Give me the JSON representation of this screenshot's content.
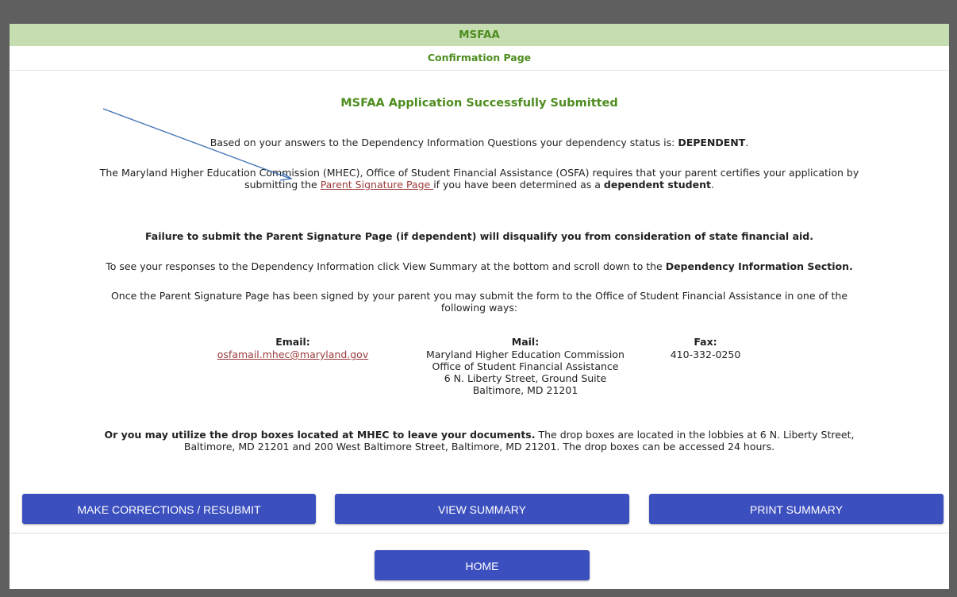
{
  "header": {
    "title": "MSFAA",
    "subtitle": "Confirmation Page"
  },
  "main": {
    "success_heading": "MSFAA Application Successfully Submitted",
    "dependency": {
      "text": "Based on your answers to the Dependency Information Questions your dependency status is: ",
      "status": "DEPENDENT",
      "end": "."
    },
    "requirement": {
      "line1": "The Maryland Higher Education Commission (MHEC), Office of Student Financial Assistance (OSFA) requires that your parent certifies your application by",
      "line2_before": "submitting the ",
      "link": "Parent Signature Page ",
      "line2_after": "if you have been determined as a ",
      "bold": "dependent student",
      "end": "."
    },
    "failure_warning": "Failure to submit the Parent Signature Page (if dependent) will disqualify you from consideration of state financial aid.",
    "responses": {
      "text": "To see your responses to the Dependency Information click View Summary at the bottom and scroll down to the ",
      "bold": "Dependency Information Section."
    },
    "submit_ways": {
      "line1": "Once the Parent Signature Page has been signed by your parent you may submit the form to the Office of Student Financial Assistance in one of the",
      "line2": "following ways:"
    },
    "contact": {
      "email_label": "Email:",
      "email": "osfamail.mhec@maryland.gov",
      "mail_label": "Mail:",
      "mail_lines": [
        "Maryland Higher Education Commission",
        "Office of Student Financial Assistance",
        "6 N. Liberty Street, Ground Suite",
        "Baltimore, MD 21201"
      ],
      "fax_label": "Fax:",
      "fax": "410-332-0250"
    },
    "drop_boxes": {
      "bold": "Or you may utilize the drop boxes located at MHEC to leave your documents.",
      "line1_rest": " The drop boxes are located in the lobbies at 6 N. Liberty Street,",
      "line2": "Baltimore, MD 21201 and 200 West Baltimore Street, Baltimore, MD 21201. The drop boxes can be accessed 24 hours."
    }
  },
  "buttons": {
    "corrections": "MAKE CORRECTIONS / RESUBMIT",
    "view_summary": "VIEW SUMMARY",
    "print_summary": "PRINT SUMMARY",
    "home": "HOME"
  },
  "colors": {
    "header_bg": "#c5ddb0",
    "accent_green": "#4e8d20",
    "button_blue": "#3b4fbe",
    "link": "#9c3a3a",
    "annotation_arrow": "#3d6fb5"
  }
}
